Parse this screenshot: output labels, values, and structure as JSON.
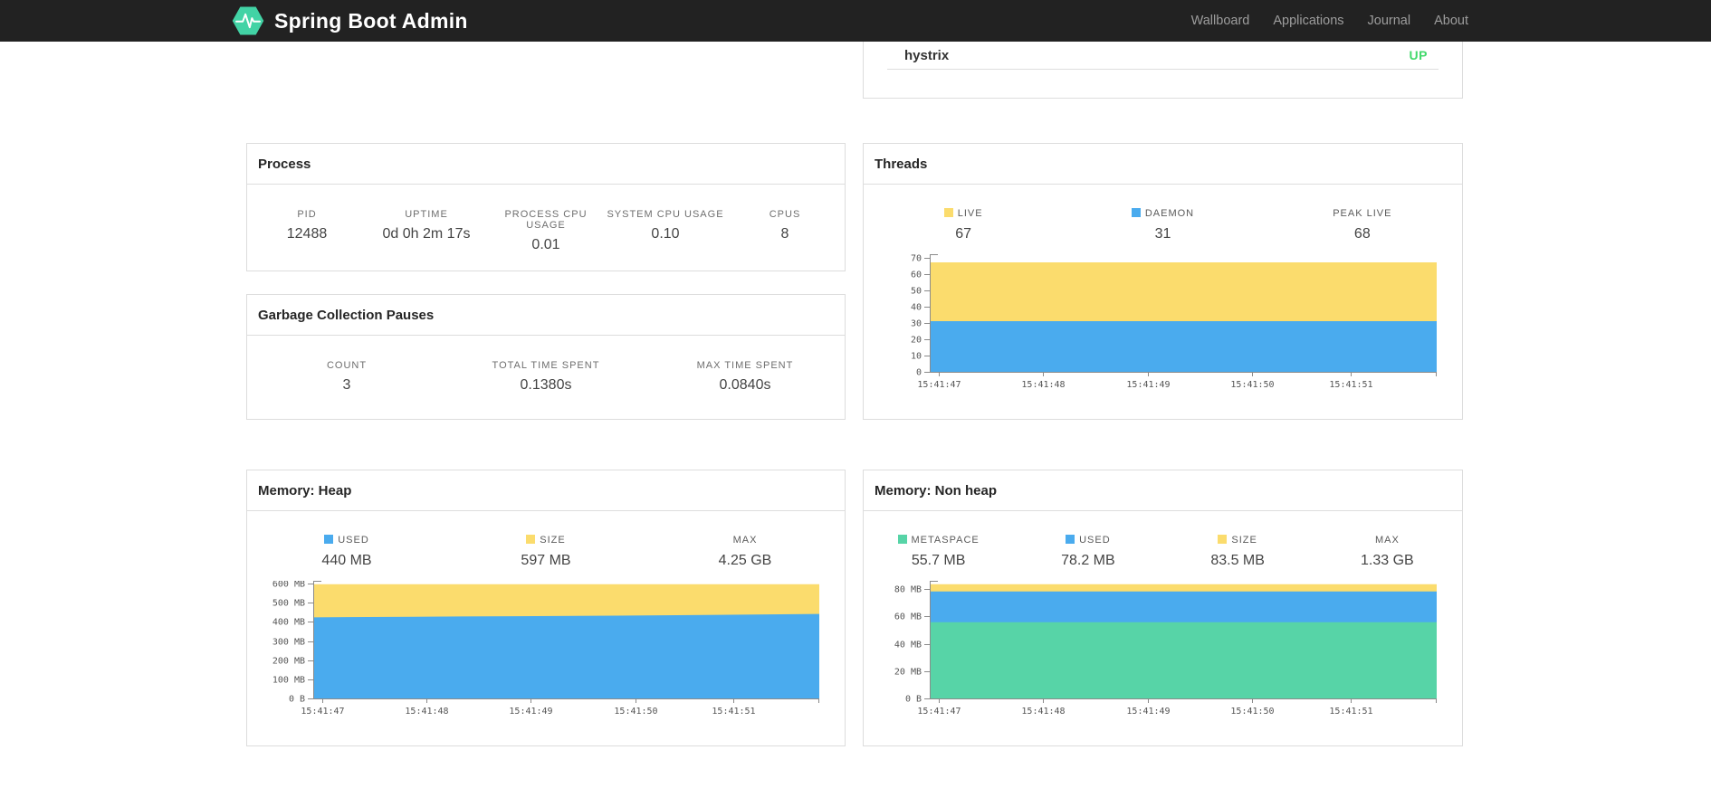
{
  "navbar": {
    "brand": "Spring Boot Admin",
    "items": [
      {
        "label": "Wallboard"
      },
      {
        "label": "Applications"
      },
      {
        "label": "Journal"
      },
      {
        "label": "About"
      }
    ]
  },
  "health": {
    "service": "hystrix",
    "status": "UP",
    "status_color": "#42d96b"
  },
  "process": {
    "title": "Process",
    "metrics": [
      {
        "label": "PID",
        "value": "12488"
      },
      {
        "label": "UPTIME",
        "value": "0d 0h 2m 17s"
      },
      {
        "label": "PROCESS CPU USAGE",
        "value": "0.01"
      },
      {
        "label": "SYSTEM CPU USAGE",
        "value": "0.10"
      },
      {
        "label": "CPUS",
        "value": "8"
      }
    ]
  },
  "gc": {
    "title": "Garbage Collection Pauses",
    "metrics": [
      {
        "label": "COUNT",
        "value": "3"
      },
      {
        "label": "TOTAL TIME SPENT",
        "value": "0.1380s"
      },
      {
        "label": "MAX TIME SPENT",
        "value": "0.0840s"
      }
    ]
  },
  "threads": {
    "title": "Threads",
    "legend": [
      {
        "label": "LIVE",
        "value": "67",
        "color": "#fbdc6d"
      },
      {
        "label": "DAEMON",
        "value": "31",
        "color": "#4aabee"
      },
      {
        "label": "PEAK LIVE",
        "value": "68"
      }
    ]
  },
  "heap": {
    "title": "Memory: Heap",
    "legend": [
      {
        "label": "USED",
        "value": "440 MB",
        "color": "#4aabee"
      },
      {
        "label": "SIZE",
        "value": "597 MB",
        "color": "#fbdc6d"
      },
      {
        "label": "MAX",
        "value": "4.25 GB"
      }
    ]
  },
  "nonheap": {
    "title": "Memory: Non heap",
    "legend": [
      {
        "label": "METASPACE",
        "value": "55.7 MB",
        "color": "#57d4a7"
      },
      {
        "label": "USED",
        "value": "78.2 MB",
        "color": "#4aabee"
      },
      {
        "label": "SIZE",
        "value": "83.5 MB",
        "color": "#fbdc6d"
      },
      {
        "label": "MAX",
        "value": "1.33 GB"
      }
    ]
  },
  "chart_data": [
    {
      "id": "threads",
      "type": "area",
      "title": "Threads",
      "legend_position": "top",
      "grid": false,
      "x_labels": [
        "15:41:47",
        "15:41:48",
        "15:41:49",
        "15:41:50",
        "15:41:51"
      ],
      "x_tick_fractions": [
        0.018,
        0.223,
        0.43,
        0.636,
        0.83
      ],
      "ylim": [
        0,
        72
      ],
      "y_ticks": [
        {
          "v": 0,
          "label": "0"
        },
        {
          "v": 10,
          "label": "10"
        },
        {
          "v": 20,
          "label": "20"
        },
        {
          "v": 30,
          "label": "30"
        },
        {
          "v": 40,
          "label": "40"
        },
        {
          "v": 50,
          "label": "50"
        },
        {
          "v": 60,
          "label": "60"
        },
        {
          "v": 70,
          "label": "70"
        }
      ],
      "series": [
        {
          "name": "LIVE",
          "color": "#fbdc6d",
          "values": [
            67,
            67,
            67,
            67,
            67,
            67
          ]
        },
        {
          "name": "DAEMON",
          "color": "#4aabee",
          "values": [
            31,
            31,
            31,
            31,
            31,
            31
          ]
        }
      ]
    },
    {
      "id": "heap",
      "type": "area",
      "title": "Memory: Heap (MB)",
      "legend_position": "top",
      "grid": false,
      "x_labels": [
        "15:41:47",
        "15:41:48",
        "15:41:49",
        "15:41:50",
        "15:41:51"
      ],
      "x_tick_fractions": [
        0.018,
        0.223,
        0.43,
        0.636,
        0.83
      ],
      "ylim": [
        0,
        615
      ],
      "y_ticks": [
        {
          "v": 0,
          "label": "0 B"
        },
        {
          "v": 100,
          "label": "100 MB"
        },
        {
          "v": 200,
          "label": "200 MB"
        },
        {
          "v": 300,
          "label": "300 MB"
        },
        {
          "v": 400,
          "label": "400 MB"
        },
        {
          "v": 500,
          "label": "500 MB"
        },
        {
          "v": 600,
          "label": "600 MB"
        }
      ],
      "series": [
        {
          "name": "SIZE",
          "color": "#fbdc6d",
          "values": [
            597,
            597,
            597,
            597,
            597,
            597
          ]
        },
        {
          "name": "USED",
          "color": "#4aabee",
          "values": [
            424,
            427,
            430,
            433,
            437,
            442
          ]
        }
      ]
    },
    {
      "id": "nonheap",
      "type": "area",
      "title": "Memory: Non heap (MB)",
      "legend_position": "top",
      "grid": false,
      "x_labels": [
        "15:41:47",
        "15:41:48",
        "15:41:49",
        "15:41:50",
        "15:41:51"
      ],
      "x_tick_fractions": [
        0.018,
        0.223,
        0.43,
        0.636,
        0.83
      ],
      "ylim": [
        0,
        86
      ],
      "y_ticks": [
        {
          "v": 0,
          "label": "0 B"
        },
        {
          "v": 20,
          "label": "20 MB"
        },
        {
          "v": 40,
          "label": "40 MB"
        },
        {
          "v": 60,
          "label": "60 MB"
        },
        {
          "v": 80,
          "label": "80 MB"
        }
      ],
      "series": [
        {
          "name": "SIZE",
          "color": "#fbdc6d",
          "values": [
            83.5,
            83.5,
            83.5,
            83.5,
            83.5,
            83.5
          ]
        },
        {
          "name": "USED",
          "color": "#4aabee",
          "values": [
            78.2,
            78.2,
            78.2,
            78.2,
            78.2,
            78.2
          ]
        },
        {
          "name": "METASPACE",
          "color": "#57d4a7",
          "values": [
            55.7,
            55.7,
            55.7,
            55.7,
            55.7,
            55.7
          ]
        }
      ]
    }
  ]
}
